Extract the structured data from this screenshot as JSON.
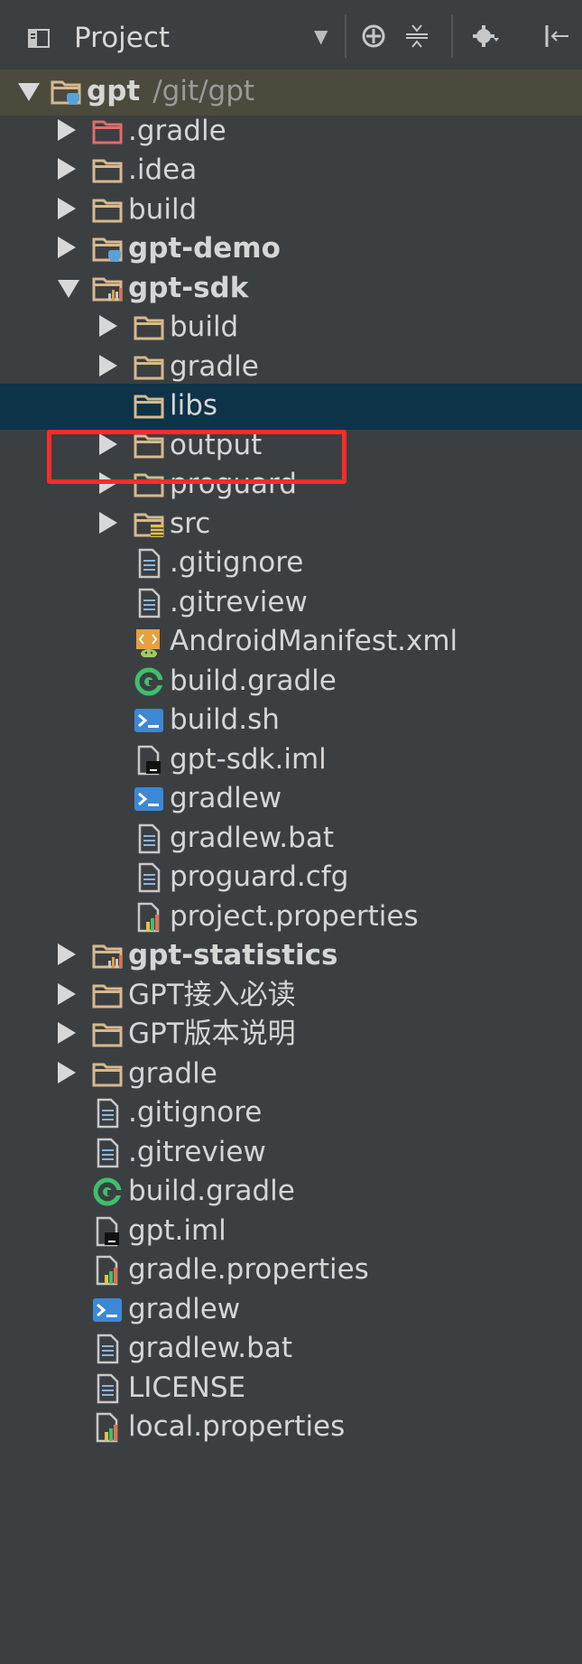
{
  "toolbar": {
    "title": "Project",
    "dropdown_icon": "chevron-down-icon",
    "buttons": [
      "locate-icon",
      "collapse-all-icon",
      "settings-icon",
      "hide-icon"
    ]
  },
  "tree": [
    {
      "label": "gpt",
      "path": "/git/gpt",
      "bold": true,
      "depth": 0,
      "arrow": "down",
      "icon": "module-folder",
      "row_style": "hl-path"
    },
    {
      "label": ".gradle",
      "depth": 1,
      "arrow": "right",
      "icon": "folder-red"
    },
    {
      "label": ".idea",
      "depth": 1,
      "arrow": "right",
      "icon": "folder"
    },
    {
      "label": "build",
      "depth": 1,
      "arrow": "right",
      "icon": "folder"
    },
    {
      "label": "gpt-demo",
      "depth": 1,
      "arrow": "right",
      "icon": "module-folder",
      "bold": true
    },
    {
      "label": "gpt-sdk",
      "depth": 1,
      "arrow": "down",
      "icon": "lib-module-folder",
      "bold": true
    },
    {
      "label": "build",
      "depth": 2,
      "arrow": "right",
      "icon": "folder"
    },
    {
      "label": "gradle",
      "depth": 2,
      "arrow": "right",
      "icon": "folder"
    },
    {
      "label": "libs",
      "depth": 2,
      "arrow": "none",
      "icon": "folder",
      "row_style": "selected"
    },
    {
      "label": "output",
      "depth": 2,
      "arrow": "right",
      "icon": "folder"
    },
    {
      "label": "proguard",
      "depth": 2,
      "arrow": "right",
      "icon": "folder"
    },
    {
      "label": "src",
      "depth": 2,
      "arrow": "right",
      "icon": "source-folder"
    },
    {
      "label": ".gitignore",
      "depth": 2,
      "arrow": "none",
      "icon": "text-file"
    },
    {
      "label": ".gitreview",
      "depth": 2,
      "arrow": "none",
      "icon": "text-file"
    },
    {
      "label": "AndroidManifest.xml",
      "depth": 2,
      "arrow": "none",
      "icon": "android-manifest"
    },
    {
      "label": "build.gradle",
      "depth": 2,
      "arrow": "none",
      "icon": "gradle"
    },
    {
      "label": "build.sh",
      "depth": 2,
      "arrow": "none",
      "icon": "shell"
    },
    {
      "label": "gpt-sdk.iml",
      "depth": 2,
      "arrow": "none",
      "icon": "iml"
    },
    {
      "label": "gradlew",
      "depth": 2,
      "arrow": "none",
      "icon": "shell"
    },
    {
      "label": "gradlew.bat",
      "depth": 2,
      "arrow": "none",
      "icon": "text-file"
    },
    {
      "label": "proguard.cfg",
      "depth": 2,
      "arrow": "none",
      "icon": "text-file"
    },
    {
      "label": "project.properties",
      "depth": 2,
      "arrow": "none",
      "icon": "properties"
    },
    {
      "label": "gpt-statistics",
      "depth": 1,
      "arrow": "right",
      "icon": "lib-module-folder",
      "bold": true
    },
    {
      "label": "GPT接入必读",
      "depth": 1,
      "arrow": "right",
      "icon": "folder"
    },
    {
      "label": "GPT版本说明",
      "depth": 1,
      "arrow": "right",
      "icon": "folder"
    },
    {
      "label": "gradle",
      "depth": 1,
      "arrow": "right",
      "icon": "folder"
    },
    {
      "label": ".gitignore",
      "depth": 1,
      "arrow": "none",
      "icon": "text-file"
    },
    {
      "label": ".gitreview",
      "depth": 1,
      "arrow": "none",
      "icon": "text-file"
    },
    {
      "label": "build.gradle",
      "depth": 1,
      "arrow": "none",
      "icon": "gradle"
    },
    {
      "label": "gpt.iml",
      "depth": 1,
      "arrow": "none",
      "icon": "iml"
    },
    {
      "label": "gradle.properties",
      "depth": 1,
      "arrow": "none",
      "icon": "properties"
    },
    {
      "label": "gradlew",
      "depth": 1,
      "arrow": "none",
      "icon": "shell"
    },
    {
      "label": "gradlew.bat",
      "depth": 1,
      "arrow": "none",
      "icon": "text-file"
    },
    {
      "label": "LICENSE",
      "depth": 1,
      "arrow": "none",
      "icon": "text-file"
    },
    {
      "label": "local.properties",
      "depth": 1,
      "arrow": "none",
      "icon": "properties"
    }
  ],
  "colors": {
    "background": "#3c3f41",
    "selection": "#0d3349",
    "highlight_box": "#ff2a2a",
    "folder": "#d7b98e",
    "text": "#d6d6d6"
  }
}
